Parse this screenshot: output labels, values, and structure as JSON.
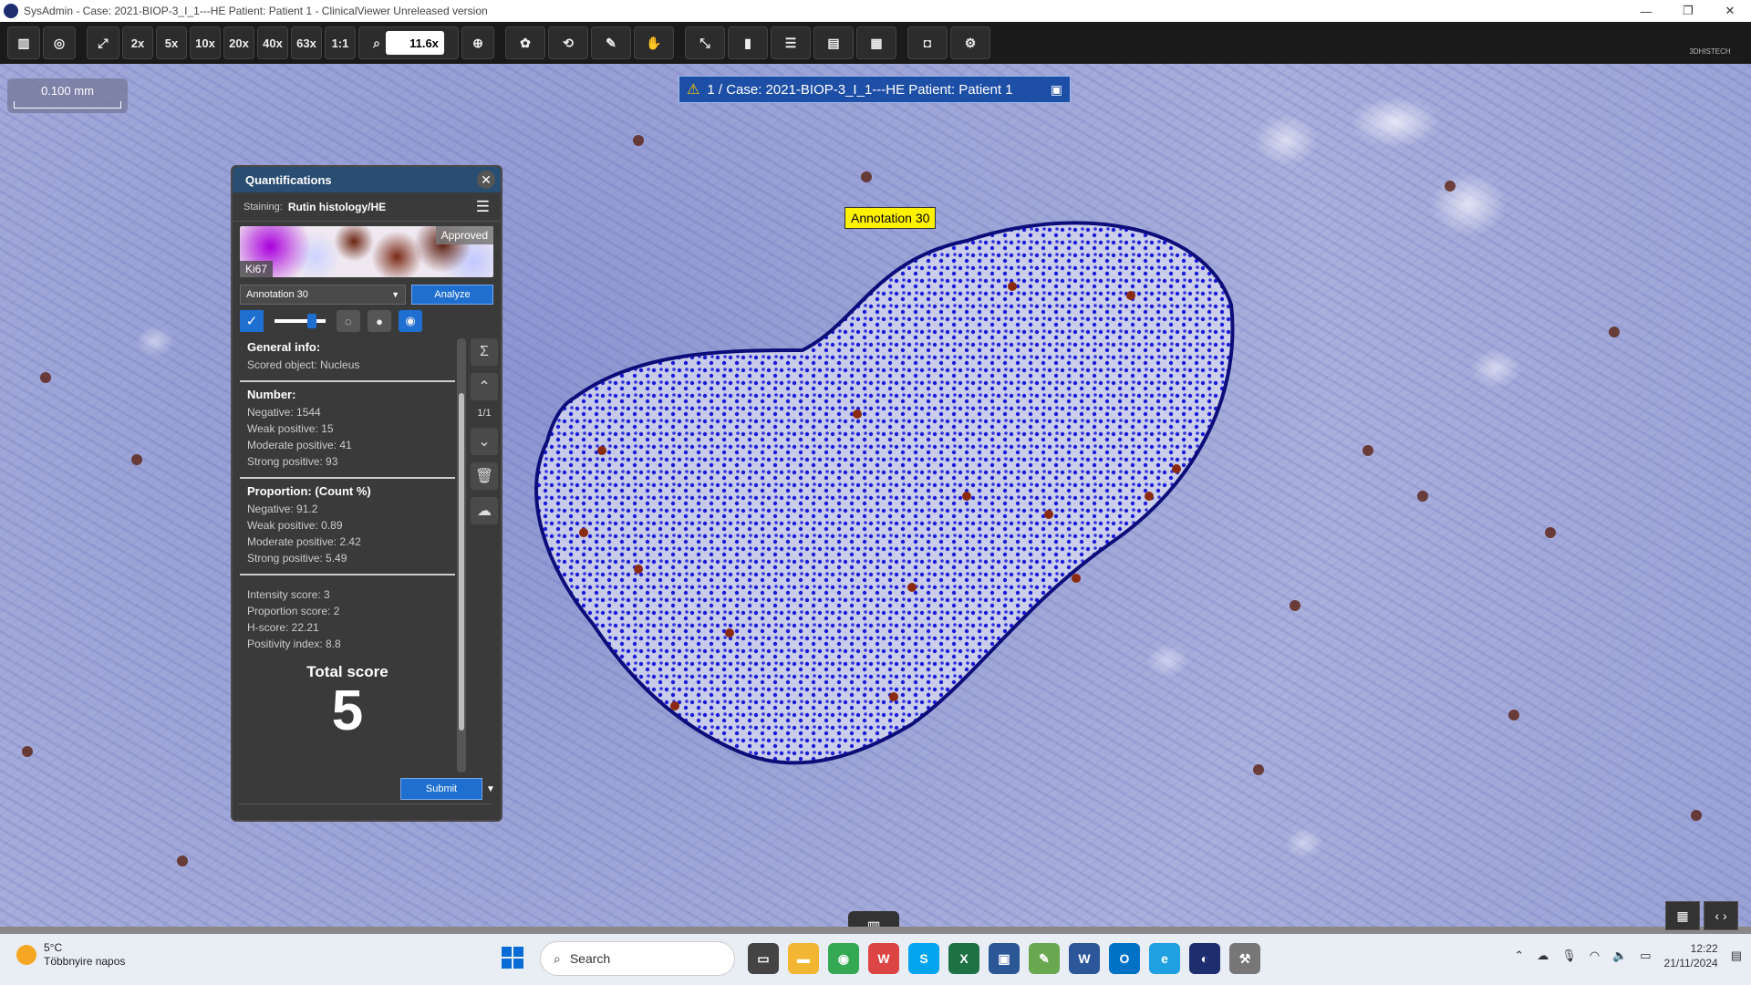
{
  "window": {
    "title": "SysAdmin - Case: 2021-BIOP-3_I_1---HE Patient: Patient 1 - ClinicalViewer Unreleased version",
    "minimize": "—",
    "maximize": "❐",
    "close": "✕"
  },
  "toolbar": {
    "zoom_presets": [
      "2x",
      "5x",
      "10x",
      "20x",
      "40x",
      "63x"
    ],
    "one_to_one": "1:1",
    "zoom_value": "11.6x",
    "brand": "3DHISTECH"
  },
  "scalebar": {
    "label": "0.100 mm"
  },
  "case_banner": {
    "text": "1 / Case: 2021-BIOP-3_I_1---HE Patient: Patient 1"
  },
  "annotation_label": "Annotation 30",
  "quantifications": {
    "title": "Quantifications",
    "staining_label": "Staining:",
    "staining_value": "Rutin histology/HE",
    "thumb_status": "Approved",
    "thumb_marker": "Ki67",
    "annotation_select": "Annotation 30",
    "analyze_button": "Analyze",
    "general_title": "General info:",
    "scored_object": "Scored object: Nucleus",
    "number_title": "Number:",
    "number": {
      "negative": "Negative: 1544",
      "weak": "Weak positive: 15",
      "moderate": "Moderate positive: 41",
      "strong": "Strong positive: 93"
    },
    "proportion_title": "Proportion: (Count %)",
    "proportion": {
      "negative": "Negative: 91.2",
      "weak": "Weak positive: 0.89",
      "moderate": "Moderate positive: 2.42",
      "strong": "Strong positive: 5.49"
    },
    "scores": {
      "intensity": "Intensity score: 3",
      "proportion": "Proportion score: 2",
      "hscore": "H-score: 22.21",
      "positivity": "Positivity index: 8.8"
    },
    "total_title": "Total score",
    "total_value": "5",
    "page_indicator": "1/1",
    "submit_button": "Submit"
  },
  "taskbar": {
    "weather_temp": "5°C",
    "weather_desc": "Többnyire napos",
    "search_placeholder": "Search",
    "time": "12:22",
    "date": "21/11/2024"
  }
}
